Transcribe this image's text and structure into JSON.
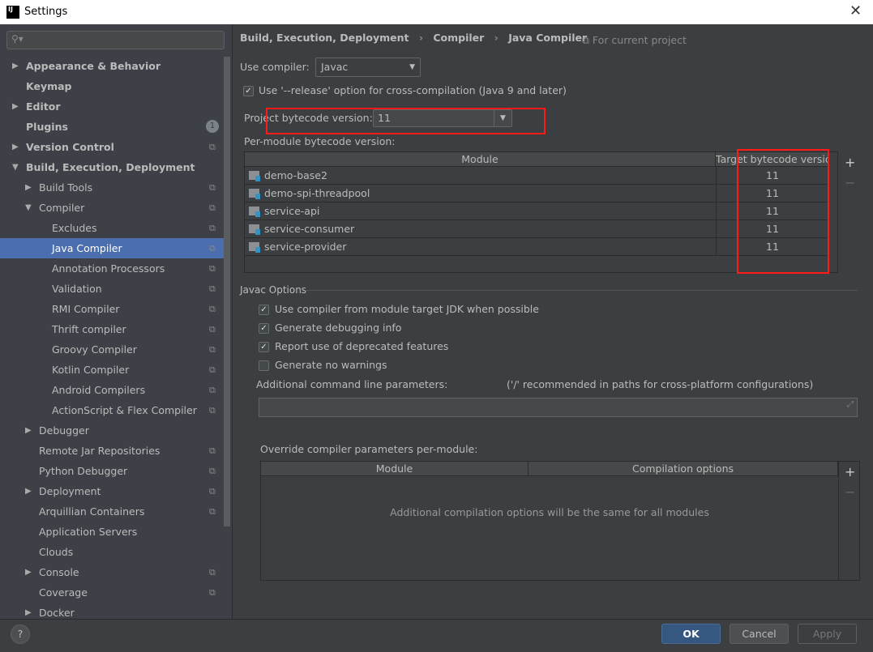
{
  "window": {
    "title": "Settings",
    "logo": "IJ"
  },
  "sidebar": {
    "items": [
      {
        "label": "Appearance & Behavior",
        "level": 0,
        "arrow": "right",
        "bold": true
      },
      {
        "label": "Keymap",
        "level": 0,
        "bold": true
      },
      {
        "label": "Editor",
        "level": 0,
        "arrow": "right",
        "bold": true
      },
      {
        "label": "Plugins",
        "level": 0,
        "bold": true,
        "badge": "1"
      },
      {
        "label": "Version Control",
        "level": 0,
        "arrow": "right",
        "bold": true,
        "copy": true
      },
      {
        "label": "Build, Execution, Deployment",
        "level": 0,
        "arrow": "down",
        "bold": true
      },
      {
        "label": "Build Tools",
        "level": 1,
        "arrow": "right",
        "copy": true
      },
      {
        "label": "Compiler",
        "level": 1,
        "arrow": "down",
        "copy": true
      },
      {
        "label": "Excludes",
        "level": 2,
        "copy": true
      },
      {
        "label": "Java Compiler",
        "level": 2,
        "copy": true,
        "selected": true
      },
      {
        "label": "Annotation Processors",
        "level": 2,
        "copy": true
      },
      {
        "label": "Validation",
        "level": 2,
        "copy": true
      },
      {
        "label": "RMI Compiler",
        "level": 2,
        "copy": true
      },
      {
        "label": "Thrift compiler",
        "level": 2,
        "copy": true
      },
      {
        "label": "Groovy Compiler",
        "level": 2,
        "copy": true
      },
      {
        "label": "Kotlin Compiler",
        "level": 2,
        "copy": true
      },
      {
        "label": "Android Compilers",
        "level": 2,
        "copy": true
      },
      {
        "label": "ActionScript & Flex Compiler",
        "level": 2,
        "copy": true
      },
      {
        "label": "Debugger",
        "level": 1,
        "arrow": "right"
      },
      {
        "label": "Remote Jar Repositories",
        "level": 1,
        "copy": true
      },
      {
        "label": "Python Debugger",
        "level": 1,
        "copy": true
      },
      {
        "label": "Deployment",
        "level": 1,
        "arrow": "right",
        "copy": true
      },
      {
        "label": "Arquillian Containers",
        "level": 1,
        "copy": true
      },
      {
        "label": "Application Servers",
        "level": 1
      },
      {
        "label": "Clouds",
        "level": 1
      },
      {
        "label": "Console",
        "level": 1,
        "arrow": "right",
        "copy": true
      },
      {
        "label": "Coverage",
        "level": 1,
        "copy": true
      },
      {
        "label": "Docker",
        "level": 1,
        "arrow": "right"
      }
    ]
  },
  "breadcrumb": [
    "Build, Execution, Deployment",
    "Compiler",
    "Java Compiler"
  ],
  "scope": "For current project",
  "use_compiler": {
    "label": "Use compiler:",
    "value": "Javac"
  },
  "release_option": {
    "label": "Use '--release' option for cross-compilation (Java 9 and later)",
    "checked": true
  },
  "project_bytecode": {
    "label": "Project bytecode version:",
    "value": "11"
  },
  "per_module": {
    "label": "Per-module bytecode version:",
    "columns": [
      "Module",
      "Target bytecode version"
    ],
    "rows": [
      {
        "module": "demo-base2",
        "version": "11"
      },
      {
        "module": "demo-spi-threadpool",
        "version": "11"
      },
      {
        "module": "service-api",
        "version": "11"
      },
      {
        "module": "service-consumer",
        "version": "11"
      },
      {
        "module": "service-provider",
        "version": "11"
      }
    ]
  },
  "javac": {
    "title": "Javac Options",
    "options": [
      {
        "label": "Use compiler from module target JDK when possible",
        "checked": true
      },
      {
        "label": "Generate debugging info",
        "checked": true
      },
      {
        "label": "Report use of deprecated features",
        "checked": true
      },
      {
        "label": "Generate no warnings",
        "checked": false
      }
    ],
    "cmd_label": "Additional command line parameters:",
    "cmd_hint": "('/' recommended in paths for cross-platform configurations)",
    "cmd_value": ""
  },
  "override": {
    "label": "Override compiler parameters per-module:",
    "columns": [
      "Module",
      "Compilation options"
    ],
    "empty": "Additional compilation options will be the same for all modules"
  },
  "buttons": {
    "ok": "OK",
    "cancel": "Cancel",
    "apply": "Apply",
    "help": "?"
  },
  "colors": {
    "selection": "#4b6eaf",
    "highlight": "#ff1a1a",
    "ok": "#365880"
  }
}
